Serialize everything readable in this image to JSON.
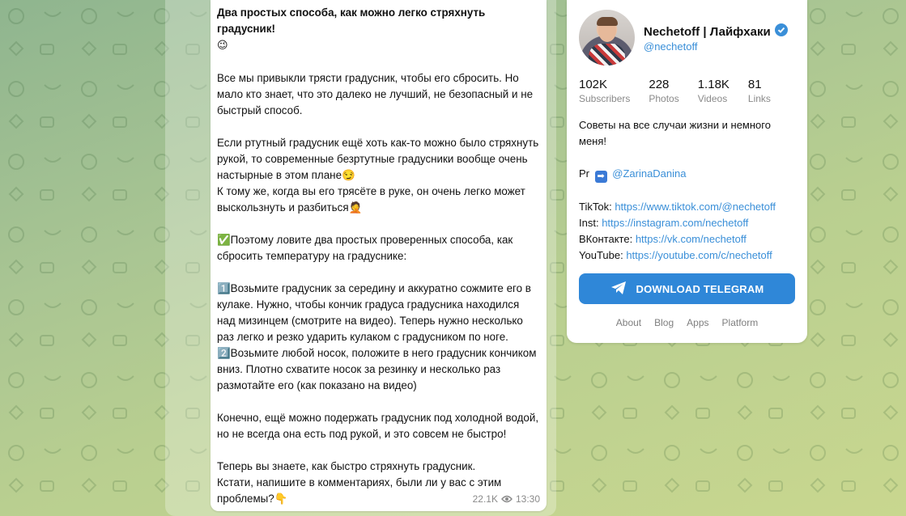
{
  "post": {
    "title": "Два простых способа, как можно легко стряхнуть градусник!",
    "title_emoji": "😉",
    "paragraphs": [
      "Все мы привыкли трясти градусник, чтобы его сбросить. Но мало кто знает, что это далеко не лучший, не безопасный и не быстрый способ.",
      "Если ртутный градусник ещё хоть как-то можно было стряхнуть рукой, то современные безртутные градусники вообще очень настырные в этом плане😏\nК тому же, когда вы его трясёте в руке, он очень легко может выскользнуть и разбиться🤦",
      "✅Поэтому ловите два простых проверенных способа, как сбросить температуру на градуснике:",
      "1️⃣Возьмите градусник за середину и аккуратно сожмите его в кулаке. Нужно, чтобы кончик градуса градусника находился над мизинцем (смотрите на видео). Теперь нужно несколько раз легко и резко ударить кулаком с градусником по ноге.\n2️⃣Возьмите любой носок, положите в него градусник кончиком вниз. Плотно схватите носок за резинку и несколько раз размотайте его (как показано на видео)",
      "Конечно, ещё можно подержать градусник под холодной водой, но не всегда она есть под рукой, и это совсем не быстро!",
      "Теперь вы знаете, как быстро стряхнуть градусник.\nКстати, напишите в комментариях, были ли у вас с этим проблемы?👇"
    ],
    "views": "22.1K",
    "time": "13:30",
    "view_icon": "eye-icon"
  },
  "channel": {
    "name": "Nechetoff | Лайфхаки",
    "verified_icon": "verified-badge-icon",
    "handle": "@nechetoff",
    "stats": [
      {
        "value": "102K",
        "label": "Subscribers"
      },
      {
        "value": "228",
        "label": "Photos"
      },
      {
        "value": "1.18K",
        "label": "Videos"
      },
      {
        "value": "81",
        "label": "Links"
      }
    ],
    "description": "Советы на все случаи жизни и немного меня!",
    "pr_label": "Pr",
    "pr_icon": "arrow-right-icon",
    "pr_link": "@ZarinaDanina",
    "links": [
      {
        "label": "TikTok:",
        "url": "https://www.tiktok.com/@nechetoff"
      },
      {
        "label": "Inst:",
        "url": "https://instagram.com/nechetoff"
      },
      {
        "label": "ВКонтакте:",
        "url": "https://vk.com/nechetoff"
      },
      {
        "label": "YouTube:",
        "url": "https://youtube.com/c/nechetoff"
      }
    ],
    "download_label": "DOWNLOAD TELEGRAM",
    "download_icon": "telegram-plane-icon"
  },
  "footer": {
    "links": [
      "About",
      "Blog",
      "Apps",
      "Platform"
    ]
  },
  "colors": {
    "accent": "#2f87d8",
    "link": "#3a8fd8",
    "background_green": "#a9c593"
  }
}
